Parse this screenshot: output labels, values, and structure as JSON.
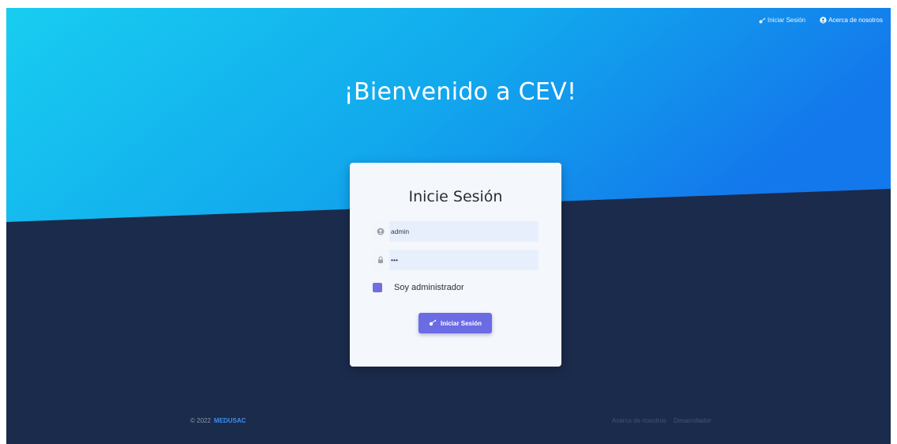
{
  "nav": {
    "login_label": "Iniciar Sesión",
    "about_label": "Acerca de nosotros"
  },
  "hero": {
    "title": "¡Bienvenido a CEV!"
  },
  "login_card": {
    "title": "Inicie Sesión",
    "username_value": "admin",
    "password_value": "•••",
    "admin_checkbox_label": "Soy administrador",
    "admin_checkbox_checked": true,
    "submit_label": "Iniciar Sesión"
  },
  "footer": {
    "copyright": "© 2022",
    "brand": "MEDUSAC",
    "links": [
      "Acerca de nosotros",
      "Desarrollador"
    ]
  },
  "colors": {
    "hero_gradient_start": "#18cdf0",
    "hero_gradient_end": "#1378ec",
    "dark_background": "#1b2b4b",
    "accent": "#6b6be4",
    "brand_link": "#3d8ff0"
  },
  "icons": {
    "nav_login": "key-icon",
    "nav_about": "user-circle-icon",
    "username": "user-icon",
    "password": "lock-icon",
    "submit": "key-icon"
  }
}
